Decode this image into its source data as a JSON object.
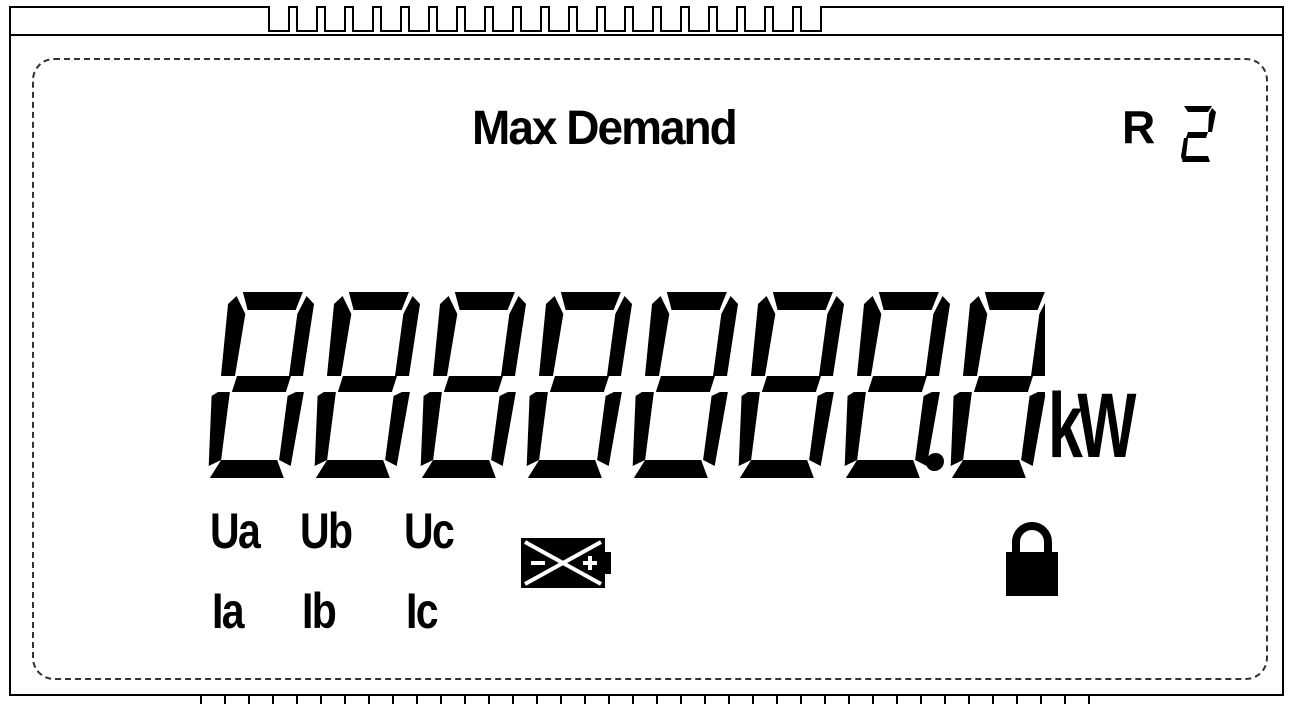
{
  "title": "Max Demand",
  "register": {
    "letter": "R",
    "digit": "2"
  },
  "display": {
    "digits": "8888888.8",
    "unit": "kW"
  },
  "phases": {
    "voltage": [
      "Ua",
      "Ub",
      "Uc"
    ],
    "current": [
      "Ia",
      "Ib",
      "Ic"
    ]
  },
  "icons": {
    "battery": "battery-fault-icon",
    "lock": "lock-icon"
  },
  "colors": {
    "segment": "#000000",
    "background": "#ffffff"
  }
}
